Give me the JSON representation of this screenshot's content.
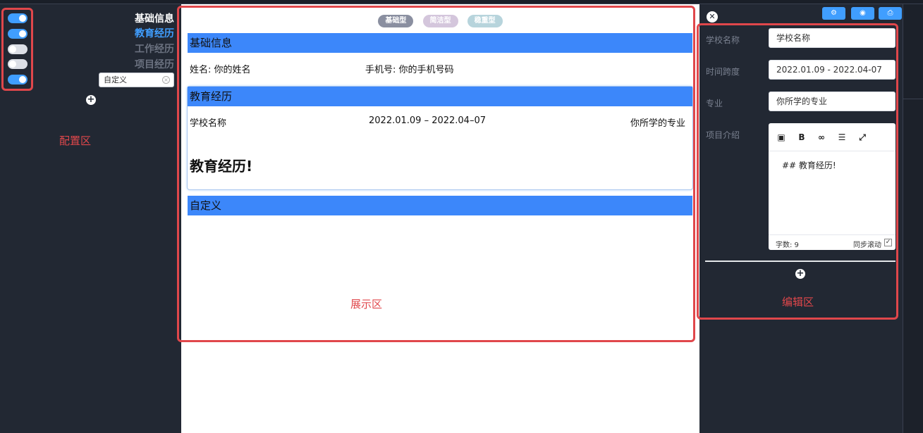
{
  "config": {
    "toggles": [
      {
        "label": "基础信息",
        "on": true
      },
      {
        "label": "教育经历",
        "on": true
      },
      {
        "label": "工作经历",
        "on": false
      },
      {
        "label": "项目经历",
        "on": false
      },
      {
        "label": "自定义",
        "on": true
      }
    ],
    "custom_input_value": "自定义",
    "add_icon": "plus-circle-icon",
    "zone_label": "配置区"
  },
  "preview": {
    "templates": [
      "基础型",
      "简洁型",
      "稳重型"
    ],
    "basic": {
      "title": "基础信息",
      "name_text": "姓名: 你的姓名",
      "phone_text": "手机号: 你的手机号码"
    },
    "education": {
      "title": "教育经历",
      "school": "学校名称",
      "period": "2022.01.09 – 2022.04–07",
      "major": "你所学的专业",
      "content_heading": "教育经历!"
    },
    "custom": {
      "title": "自定义"
    },
    "zone_label": "展示区"
  },
  "editor": {
    "toolbar_icons": [
      "settings-icon",
      "eye-icon",
      "print-icon"
    ],
    "fields": {
      "school": {
        "label": "学校名称",
        "value": "学校名称"
      },
      "period": {
        "label": "时间跨度",
        "value": "2022.01.09 - 2022.04-07"
      },
      "major": {
        "label": "专业",
        "value": "你所学的专业"
      },
      "intro": {
        "label": "项目介绍"
      }
    },
    "md": {
      "tool_icons": [
        "image-icon",
        "bold-icon",
        "link-icon",
        "list-icon",
        "fullscreen-icon"
      ],
      "content": "## 教育经历!",
      "count_text": "字数: 9",
      "sync_label": "同步滚动",
      "sync_checked": true
    },
    "zone_label": "编辑区"
  },
  "colors": {
    "accent": "#409eff",
    "section_header": "#3c87fa",
    "annotation": "#e0474b",
    "panel_bg": "#222833"
  }
}
